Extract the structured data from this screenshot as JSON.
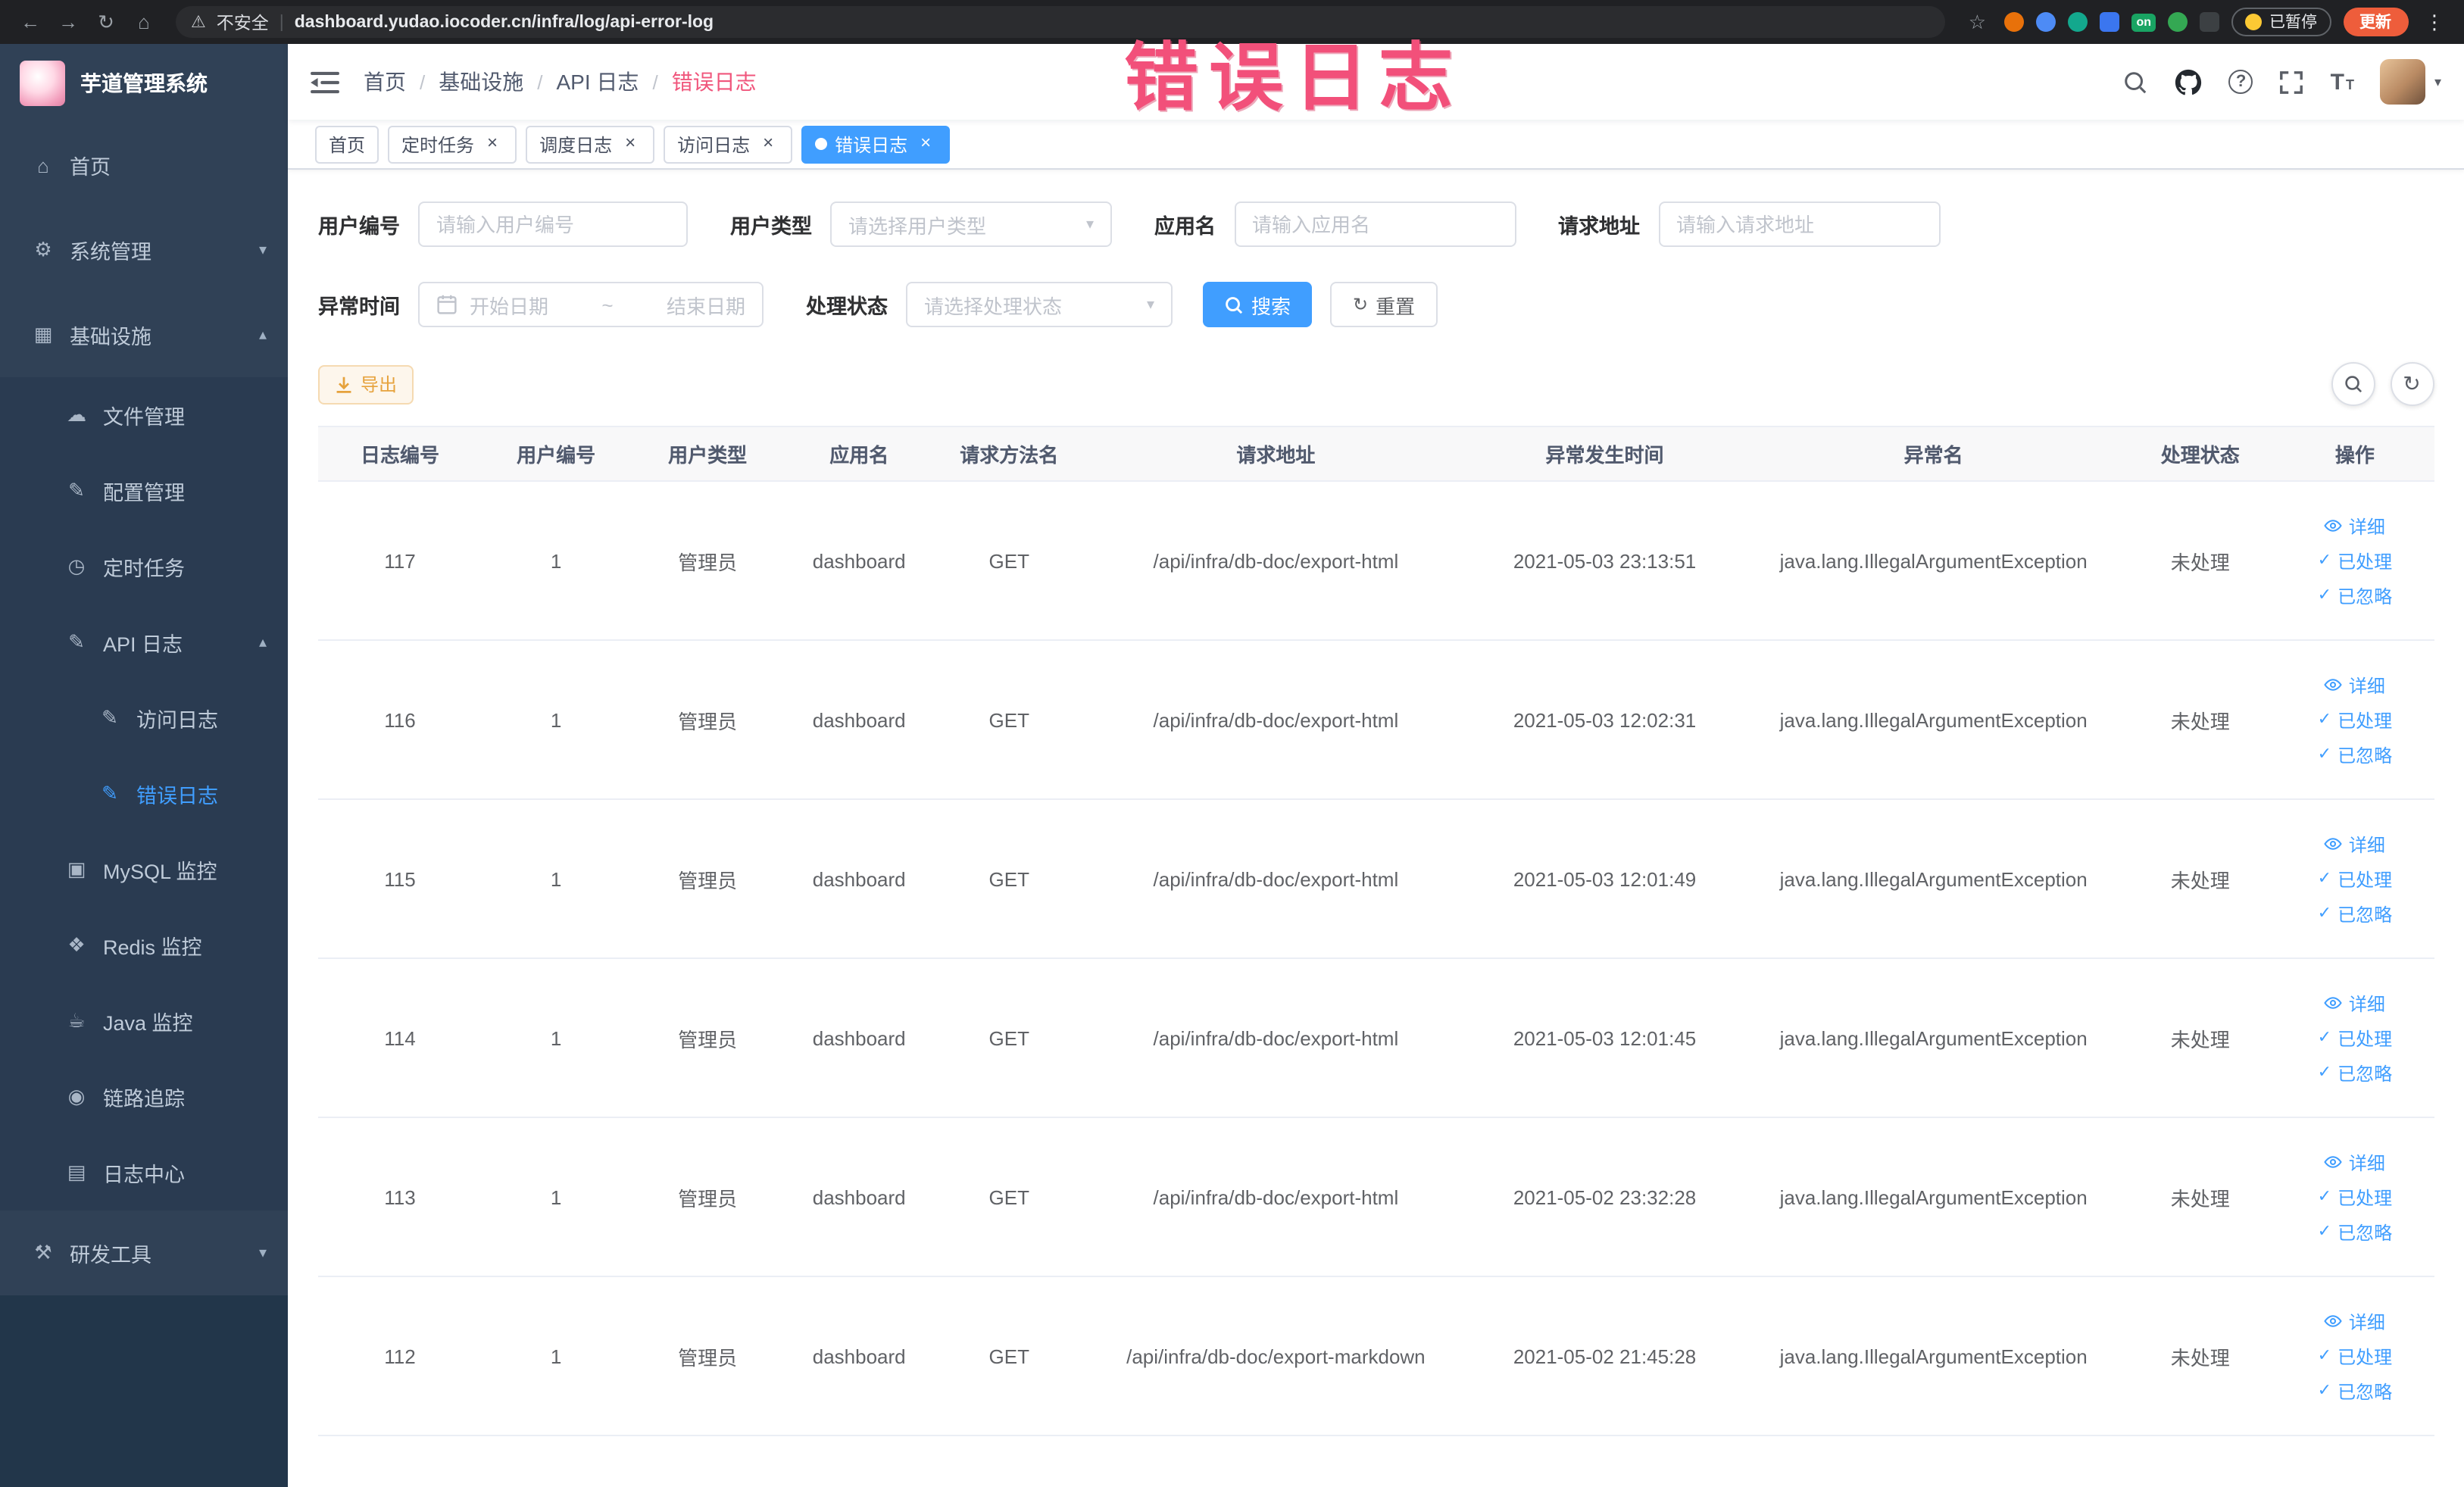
{
  "browser": {
    "security_label": "不安全",
    "url": "dashboard.yudao.iocoder.cn/infra/log/api-error-log",
    "extension_on_badge": "on",
    "paused_badge": "已暂停",
    "update_button": "更新"
  },
  "annotation": {
    "text": "错误日志"
  },
  "sidebar": {
    "logo_title": "芋道管理系统",
    "items": [
      {
        "label": "首页",
        "name": "home",
        "icon": "home-icon",
        "depth": 0
      },
      {
        "label": "系统管理",
        "name": "system-management",
        "icon": "gear-icon",
        "depth": 0,
        "arrow": "down"
      },
      {
        "label": "基础设施",
        "name": "infrastructure",
        "icon": "infrastructure-icon",
        "depth": 0,
        "arrow": "up"
      },
      {
        "label": "文件管理",
        "name": "file-management",
        "icon": "file-manage-icon",
        "depth": 1
      },
      {
        "label": "配置管理",
        "name": "config-management",
        "icon": "config-manage-icon",
        "depth": 1
      },
      {
        "label": "定时任务",
        "name": "scheduled-jobs",
        "icon": "scheduled-job-icon",
        "depth": 1
      },
      {
        "label": "API 日志",
        "name": "api-logs",
        "icon": "api-log-icon",
        "depth": 1,
        "arrow": "up"
      },
      {
        "label": "访问日志",
        "name": "access-log",
        "icon": "access-log-icon",
        "depth": 2
      },
      {
        "label": "错误日志",
        "name": "error-log",
        "icon": "error-log-icon",
        "depth": 2,
        "active": true
      },
      {
        "label": "MySQL 监控",
        "name": "mysql-monitor",
        "icon": "mysql-monitor-icon",
        "depth": 1
      },
      {
        "label": "Redis 监控",
        "name": "redis-monitor",
        "icon": "redis-monitor-icon",
        "depth": 1
      },
      {
        "label": "Java 监控",
        "name": "java-monitor",
        "icon": "java-monitor-icon",
        "depth": 1
      },
      {
        "label": "链路追踪",
        "name": "link-tracing",
        "icon": "trace-icon",
        "depth": 1
      },
      {
        "label": "日志中心",
        "name": "log-center",
        "icon": "log-center-icon",
        "depth": 1
      },
      {
        "label": "研发工具",
        "name": "dev-tools",
        "icon": "dev-tools-icon",
        "depth": 0,
        "arrow": "down"
      }
    ]
  },
  "header": {
    "breadcrumb": [
      "首页",
      "基础设施",
      "API 日志",
      "错误日志"
    ]
  },
  "tabs": [
    {
      "label": "首页",
      "name": "tab-home",
      "closable": false,
      "active": false
    },
    {
      "label": "定时任务",
      "name": "tab-scheduled-jobs",
      "closable": true,
      "active": false
    },
    {
      "label": "调度日志",
      "name": "tab-job-log",
      "closable": true,
      "active": false
    },
    {
      "label": "访问日志",
      "name": "tab-access-log",
      "closable": true,
      "active": false
    },
    {
      "label": "错误日志",
      "name": "tab-error-log",
      "closable": true,
      "active": true
    }
  ],
  "filters": {
    "user_id": {
      "label": "用户编号",
      "placeholder": "请输入用户编号"
    },
    "user_type": {
      "label": "用户类型",
      "placeholder": "请选择用户类型"
    },
    "app_name": {
      "label": "应用名",
      "placeholder": "请输入应用名"
    },
    "request_url": {
      "label": "请求地址",
      "placeholder": "请输入请求地址"
    },
    "exception_time": {
      "label": "异常时间",
      "start_placeholder": "开始日期",
      "separator": "~",
      "end_placeholder": "结束日期"
    },
    "process_status": {
      "label": "处理状态",
      "placeholder": "请选择处理状态"
    },
    "search_button": "搜索",
    "reset_button": "重置"
  },
  "toolbar": {
    "export_button": "导出"
  },
  "table": {
    "columns": [
      "日志编号",
      "用户编号",
      "用户类型",
      "应用名",
      "请求方法名",
      "请求地址",
      "异常发生时间",
      "异常名",
      "处理状态",
      "操作"
    ],
    "actions": [
      "详细",
      "已处理",
      "已忽略"
    ],
    "rows": [
      {
        "id": "117",
        "user_id": "1",
        "user_type": "管理员",
        "app": "dashboard",
        "method": "GET",
        "url": "/api/infra/db-doc/export-html",
        "time": "2021-05-03 23:13:51",
        "exception": "java.lang.IllegalArgumentException",
        "status": "未处理"
      },
      {
        "id": "116",
        "user_id": "1",
        "user_type": "管理员",
        "app": "dashboard",
        "method": "GET",
        "url": "/api/infra/db-doc/export-html",
        "time": "2021-05-03 12:02:31",
        "exception": "java.lang.IllegalArgumentException",
        "status": "未处理"
      },
      {
        "id": "115",
        "user_id": "1",
        "user_type": "管理员",
        "app": "dashboard",
        "method": "GET",
        "url": "/api/infra/db-doc/export-html",
        "time": "2021-05-03 12:01:49",
        "exception": "java.lang.IllegalArgumentException",
        "status": "未处理"
      },
      {
        "id": "114",
        "user_id": "1",
        "user_type": "管理员",
        "app": "dashboard",
        "method": "GET",
        "url": "/api/infra/db-doc/export-html",
        "time": "2021-05-03 12:01:45",
        "exception": "java.lang.IllegalArgumentException",
        "status": "未处理"
      },
      {
        "id": "113",
        "user_id": "1",
        "user_type": "管理员",
        "app": "dashboard",
        "method": "GET",
        "url": "/api/infra/db-doc/export-html",
        "time": "2021-05-02 23:32:28",
        "exception": "java.lang.IllegalArgumentException",
        "status": "未处理"
      },
      {
        "id": "112",
        "user_id": "1",
        "user_type": "管理员",
        "app": "dashboard",
        "method": "GET",
        "url": "/api/infra/db-doc/export-markdown",
        "time": "2021-05-02 21:45:28",
        "exception": "java.lang.IllegalArgumentException",
        "status": "未处理"
      }
    ]
  },
  "colors": {
    "accent": "#409EFF",
    "annotation_pink": "#F2507A",
    "warning_orange": "#E6A23C",
    "sidebar_dark": "#304156"
  }
}
